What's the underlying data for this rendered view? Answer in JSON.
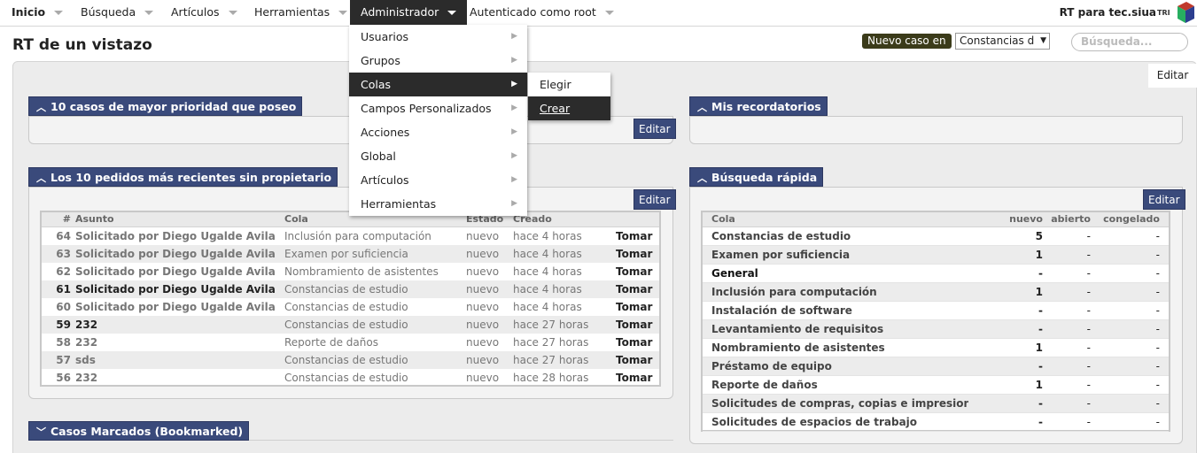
{
  "nav": {
    "items": [
      "Inicio",
      "Búsqueda",
      "Artículos",
      "Herramientas",
      "Administrador",
      "Autenticado como root"
    ],
    "brand": "RT para tec.siua",
    "logo_text": "TRI"
  },
  "header": {
    "title": "RT de un vistazo",
    "new_case": "Nuevo caso en",
    "queue_selected": "Constancias d",
    "search_placeholder": "Búsqueda...",
    "edit": "Editar"
  },
  "admin_menu": {
    "items": [
      "Usuarios",
      "Grupos",
      "Colas",
      "Campos Personalizados",
      "Acciones",
      "Global",
      "Artículos",
      "Herramientas"
    ],
    "selected": "Colas",
    "submenu": [
      "Elegir",
      "Crear"
    ]
  },
  "panels": {
    "top_priority": {
      "title": "10 casos de mayor prioridad que poseo",
      "edit": "Editar"
    },
    "reminders": {
      "title": "Mis recordatorios"
    },
    "recent_unowned": {
      "title": "Los 10 pedidos más recientes sin propietario",
      "edit": "Editar",
      "columns": [
        "#",
        "Asunto",
        "Cola",
        "Estado",
        "Creado"
      ],
      "action": "Tomar",
      "rows": [
        {
          "id": "64",
          "subject": "Solicitado por Diego Ugalde Avila",
          "queue": "Inclusión para computación",
          "status": "nuevo",
          "created": "hace 4 horas"
        },
        {
          "id": "63",
          "subject": "Solicitado por Diego Ugalde Avila",
          "queue": "Examen por suficiencia",
          "status": "nuevo",
          "created": "hace 4 horas"
        },
        {
          "id": "62",
          "subject": "Solicitado por Diego Ugalde Avila",
          "queue": "Nombramiento de asistentes",
          "status": "nuevo",
          "created": "hace 4 horas"
        },
        {
          "id": "61",
          "subject": "Solicitado por Diego Ugalde Avila",
          "queue": "Constancias de estudio",
          "status": "nuevo",
          "created": "hace 4 horas"
        },
        {
          "id": "60",
          "subject": "Solicitado por Diego Ugalde Avila",
          "queue": "Constancias de estudio",
          "status": "nuevo",
          "created": "hace 4 horas"
        },
        {
          "id": "59",
          "subject": "232",
          "queue": "Constancias de estudio",
          "status": "nuevo",
          "created": "hace 27 horas"
        },
        {
          "id": "58",
          "subject": "232",
          "queue": "Reporte de daños",
          "status": "nuevo",
          "created": "hace 27 horas"
        },
        {
          "id": "57",
          "subject": "sds",
          "queue": "Constancias de estudio",
          "status": "nuevo",
          "created": "hace 27 horas"
        },
        {
          "id": "56",
          "subject": "232",
          "queue": "Constancias de estudio",
          "status": "nuevo",
          "created": "hace 28 horas"
        }
      ]
    },
    "quick_search": {
      "title": "Búsqueda rápida",
      "edit": "Editar",
      "columns": [
        "Cola",
        "nuevo",
        "abierto",
        "congelado"
      ],
      "rows": [
        {
          "queue": "Constancias de estudio",
          "new": "5",
          "open": "-",
          "frozen": "-"
        },
        {
          "queue": "Examen por suficiencia",
          "new": "1",
          "open": "-",
          "frozen": "-"
        },
        {
          "queue": "General",
          "new": "-",
          "open": "-",
          "frozen": "-"
        },
        {
          "queue": "Inclusión para computación",
          "new": "1",
          "open": "-",
          "frozen": "-"
        },
        {
          "queue": "Instalación de software",
          "new": "-",
          "open": "-",
          "frozen": "-"
        },
        {
          "queue": "Levantamiento de requisitos",
          "new": "-",
          "open": "-",
          "frozen": "-"
        },
        {
          "queue": "Nombramiento de asistentes",
          "new": "1",
          "open": "-",
          "frozen": "-"
        },
        {
          "queue": "Préstamo de equipo",
          "new": "-",
          "open": "-",
          "frozen": "-"
        },
        {
          "queue": "Reporte de daños",
          "new": "1",
          "open": "-",
          "frozen": "-"
        },
        {
          "queue": "Solicitudes de compras, copias e impresiones",
          "new": "-",
          "open": "-",
          "frozen": "-"
        },
        {
          "queue": "Solicitudes de espacios de trabajo",
          "new": "-",
          "open": "-",
          "frozen": "-"
        }
      ]
    },
    "bookmarked": {
      "title": "Casos Marcados (Bookmarked)"
    }
  }
}
